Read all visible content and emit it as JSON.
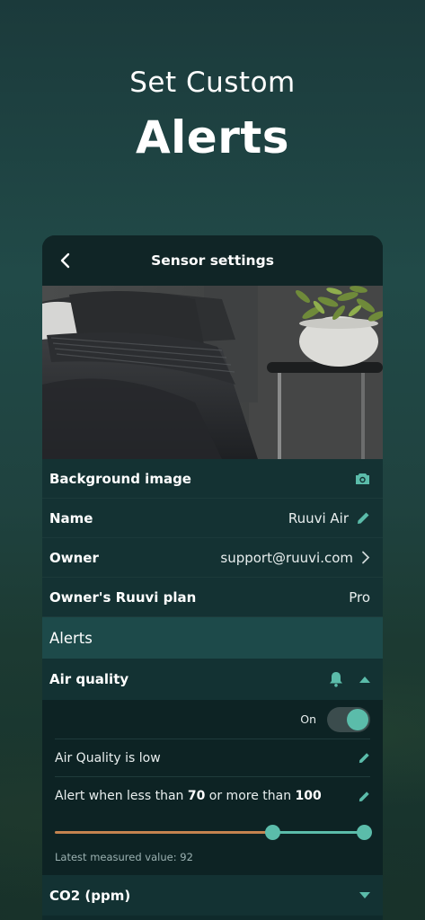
{
  "hero": {
    "subtitle": "Set Custom",
    "title": "Alerts"
  },
  "app_bar": {
    "title": "Sensor settings"
  },
  "settings": {
    "background_image_label": "Background image",
    "name_label": "Name",
    "name_value": "Ruuvi Air",
    "owner_label": "Owner",
    "owner_value": "support@ruuvi.com",
    "plan_label": "Owner's Ruuvi plan",
    "plan_value": "Pro"
  },
  "alerts": {
    "section_title": "Alerts",
    "air_quality": {
      "title": "Air quality",
      "toggle_label": "On",
      "toggle_on": true,
      "description": "Air Quality is low",
      "range_prefix": "Alert when less than",
      "range_low": "70",
      "range_mid": "or more than",
      "range_high": "100",
      "latest": "Latest measured value: 92"
    },
    "co2": {
      "title": "CO2 (ppm)"
    }
  },
  "colors": {
    "accent": "#5bbcaa",
    "slider_low": "#c4834f",
    "section_header": "#1d4a4a"
  },
  "icons": [
    "chevron-left-icon",
    "camera-icon",
    "pencil-icon",
    "chevron-right-icon",
    "bell-icon",
    "triangle-up-icon",
    "triangle-down-icon"
  ]
}
